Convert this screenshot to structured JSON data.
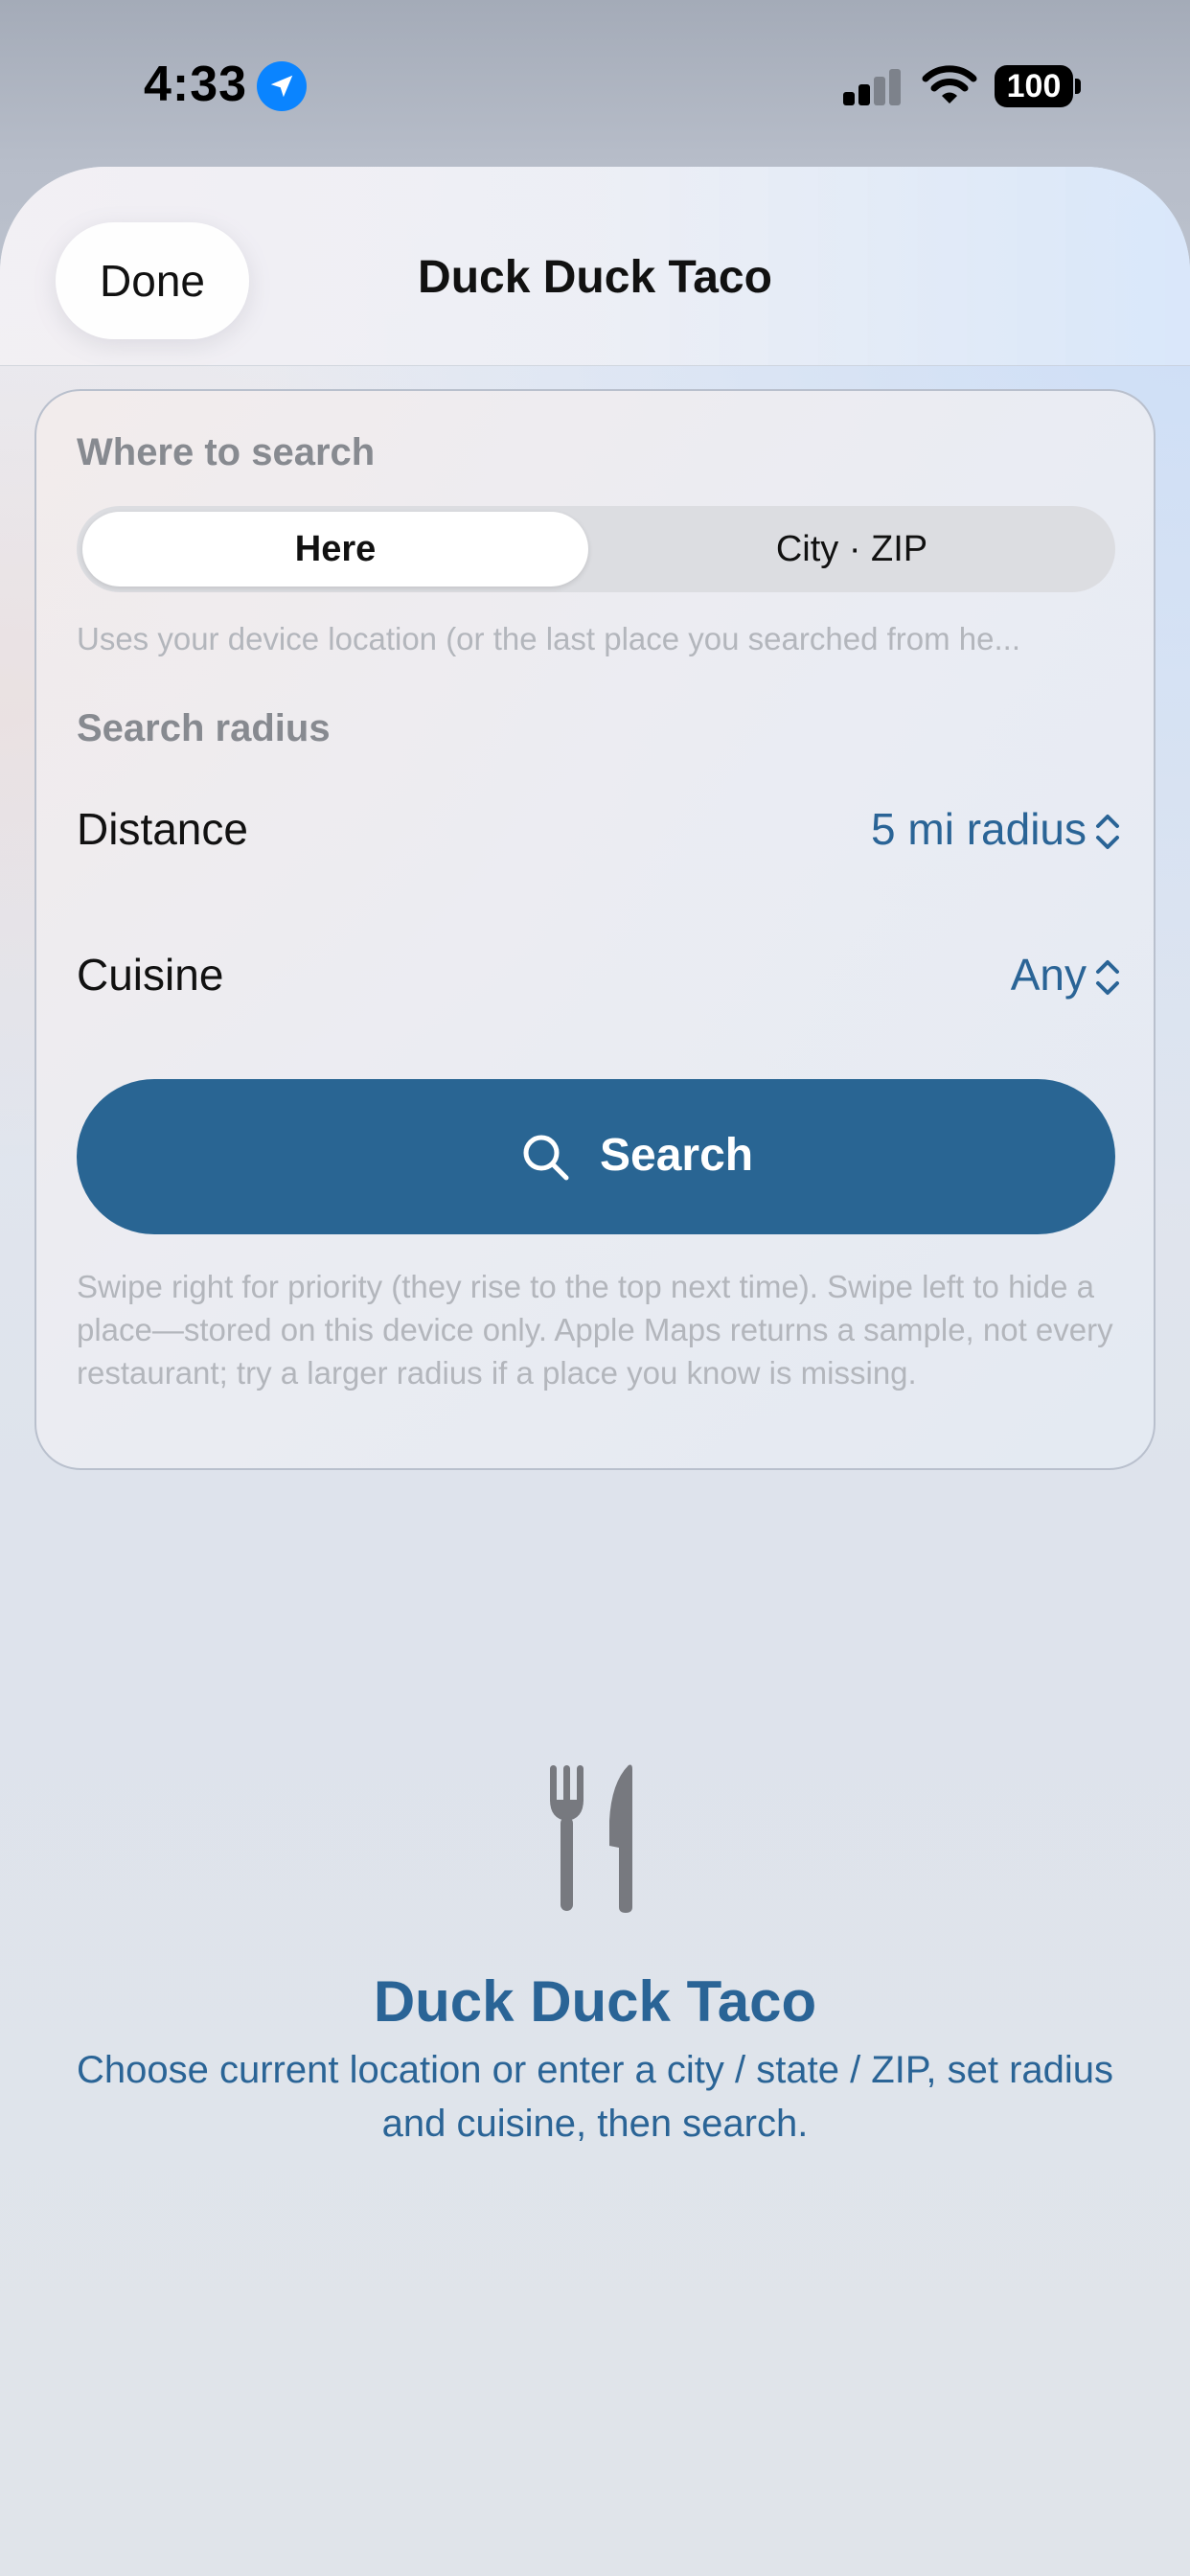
{
  "status_bar": {
    "time": "4:33",
    "battery": "100",
    "icons": [
      "location-arrow-icon",
      "cellular-signal-icon",
      "wifi-icon",
      "battery-icon"
    ]
  },
  "nav": {
    "done_label": "Done",
    "title": "Duck Duck Taco"
  },
  "form": {
    "where_label": "Where to search",
    "segments": [
      "Here",
      "City · ZIP"
    ],
    "selected_segment": "Here",
    "location_hint": "Uses your device location (or the last place you searched from he...",
    "radius_label": "Search radius",
    "distance": {
      "label": "Distance",
      "value": "5 mi radius"
    },
    "cuisine": {
      "label": "Cuisine",
      "value": "Any"
    },
    "search_label": "Search",
    "footnote": "Swipe right for priority (they rise to the top next time). Swipe left to hide a place—stored on this device only. Apple Maps returns a sample, not every restaurant; try a larger radius if a place you know is missing."
  },
  "empty_state": {
    "icon": "fork-knife-icon",
    "title": "Duck Duck Taco",
    "body": "Choose current location or enter a city / state / ZIP, set radius and cuisine, then search."
  },
  "colors": {
    "accent": "#2a6496",
    "button": "#296593",
    "location_blue": "#0a84ff"
  }
}
